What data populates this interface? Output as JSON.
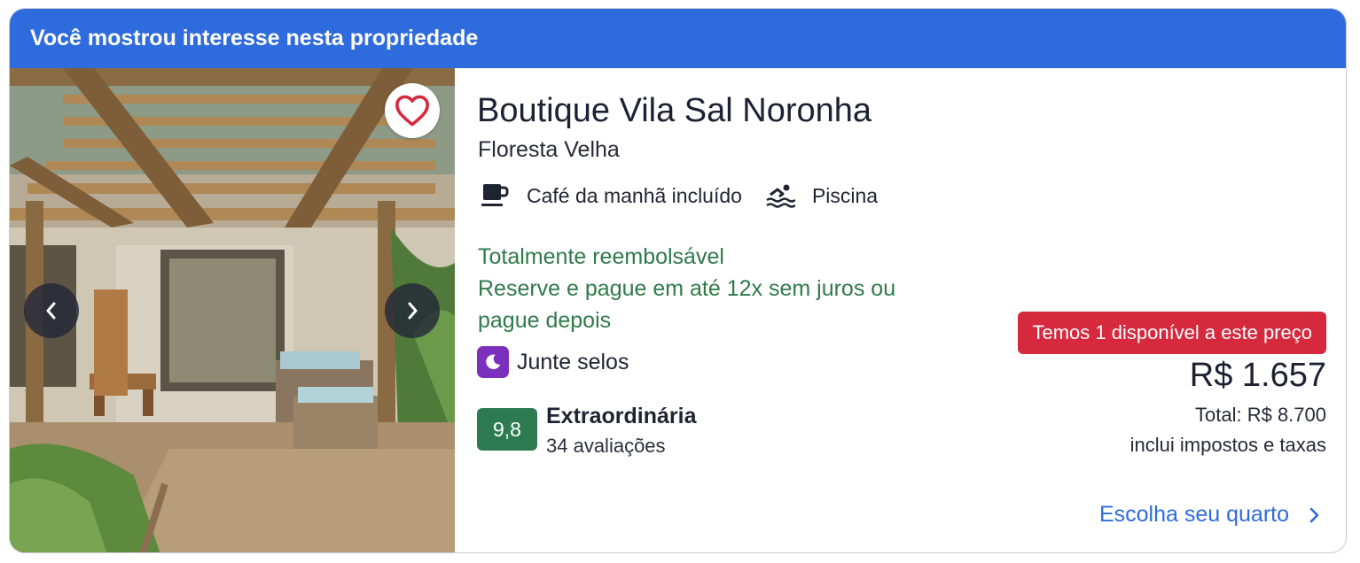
{
  "banner": {
    "text": "Você mostrou interesse nesta propriedade"
  },
  "gallery": {
    "favorite_icon": "heart-outline-icon",
    "prev_icon": "chevron-left-icon",
    "next_icon": "chevron-right-icon"
  },
  "property": {
    "name": "Boutique Vila Sal Noronha",
    "neighborhood": "Floresta Velha",
    "amenities": [
      {
        "icon": "coffee-cup-icon",
        "label": "Café da manhã incluído"
      },
      {
        "icon": "pool-swimmer-icon",
        "label": "Piscina"
      }
    ],
    "refund": "Totalmente reembolsável",
    "payment_line1": "Reserve e pague em até 12x sem juros ou",
    "payment_line2": "pague depois",
    "stamps": {
      "icon": "moon-icon",
      "label": "Junte selos"
    },
    "rating": {
      "score": "9,8",
      "label": "Extraordinária",
      "count": "34 avaliações"
    }
  },
  "pricing": {
    "availability": "Temos 1 disponível a este preço",
    "nightly": "R$ 1.657",
    "total": "Total: R$ 8.700",
    "taxes_note": "inclui impostos e taxas"
  },
  "cta": {
    "label": "Escolha seu quarto",
    "icon": "chevron-right-icon"
  },
  "colors": {
    "banner": "#2e6bdd",
    "green_text": "#2f7a4a",
    "rating_badge": "#2d7a50",
    "alert": "#d7293d",
    "stamps_badge": "#7b2fbd",
    "link": "#2e6bdd"
  }
}
